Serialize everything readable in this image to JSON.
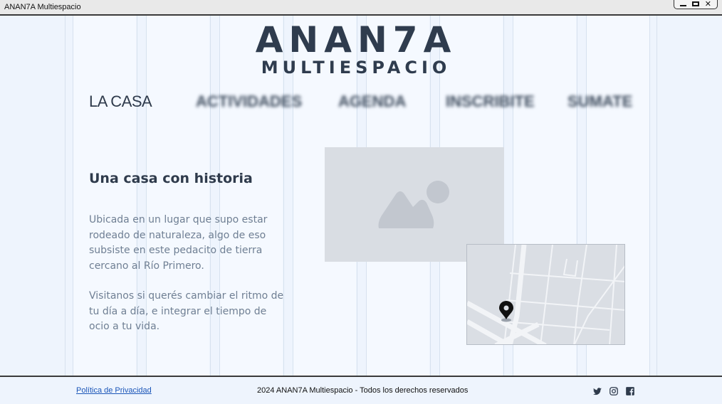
{
  "window": {
    "title": "ANAN7A Multiespacio",
    "controls": [
      "minimize",
      "maximize",
      "close"
    ]
  },
  "logo": {
    "main": "ANAN7A",
    "sub": "MULTIESPACIO"
  },
  "nav": {
    "items": [
      {
        "label": "LA CASA",
        "active": true
      },
      {
        "label": "ACTIVIDADES",
        "blurred": true
      },
      {
        "label": "AGENDA",
        "blurred": true
      },
      {
        "label": "INSCRIBITE",
        "blurred": true
      },
      {
        "label": "SUMATE",
        "blurred": true
      }
    ]
  },
  "content": {
    "heading": "Una casa con historia",
    "paragraph1": "Ubicada en un lugar que supo estar rodeado de naturaleza, algo de eso subsiste en este pedacito de tierra cercano al Río Primero.",
    "paragraph2": "Visitanos si querés cambiar el ritmo de tu día a día, e integrar el tiempo de ocio a tu vida.",
    "image_icon": "image-placeholder-icon",
    "map_icon": "map-pin-icon"
  },
  "footer": {
    "policy_link": "Política de Privacidad",
    "copyright": "2024 ANAN7A Multiespacio - Todos los derechos reservados",
    "social": [
      "twitter-icon",
      "instagram-icon",
      "facebook-icon"
    ]
  },
  "colors": {
    "background": "#eef4fd",
    "text_dark": "#2f3b4c",
    "text_muted": "#6f7f93",
    "link": "#1a55b8",
    "placeholder": "#d9dde3"
  }
}
